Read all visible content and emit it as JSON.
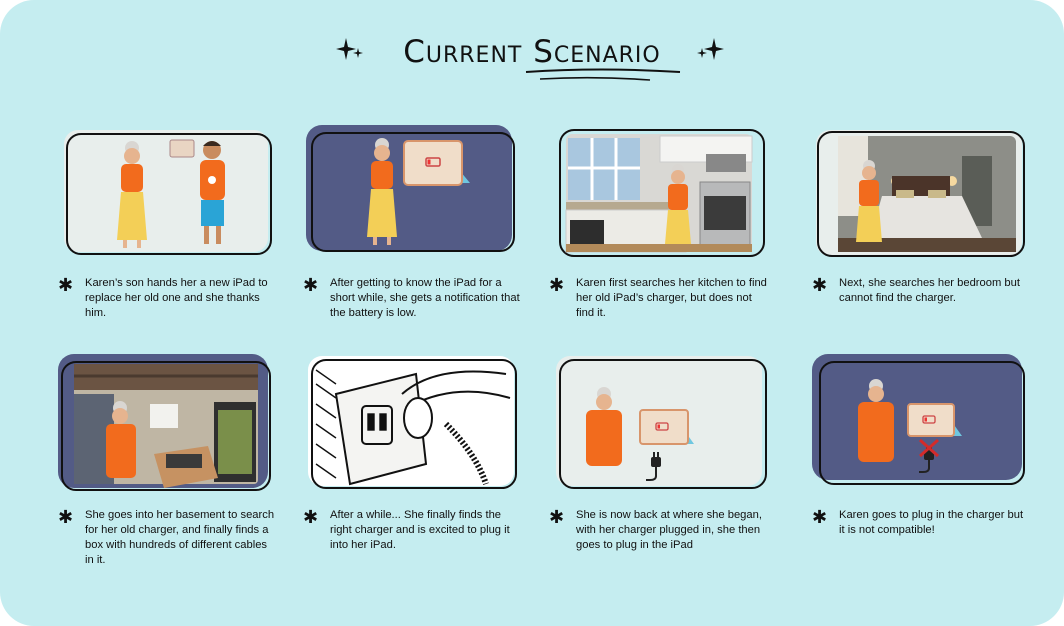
{
  "title": "Current Scenario",
  "colors": {
    "background": "#c5edf0",
    "panel_light": "#e8eeec",
    "panel_dark": "#535b86",
    "shirt": "#f26b1d",
    "skirt": "#f3cf57",
    "pants": "#2aa4d6"
  },
  "panels": [
    {
      "caption": "Karen’s son hands her a new iPad to replace her old one and she thanks him."
    },
    {
      "caption": "After getting to know the iPad for a short while, she gets a notification that the battery is low."
    },
    {
      "caption": "Karen first searches her kitchen to find her old iPad’s charger, but does not find it."
    },
    {
      "caption": "Next, she searches her bedroom but cannot find the charger."
    },
    {
      "caption": "She goes into her basement to search for her old charger, and finally finds a box with hundreds of different cables in it."
    },
    {
      "caption": "After a while... She finally finds the right charger and is excited to plug it into her iPad."
    },
    {
      "caption": "She is now back at where she began, with her charger plugged in, she then goes to plug in the iPad"
    },
    {
      "caption": "Karen goes to plug in the charger but it is not compatible!"
    }
  ]
}
